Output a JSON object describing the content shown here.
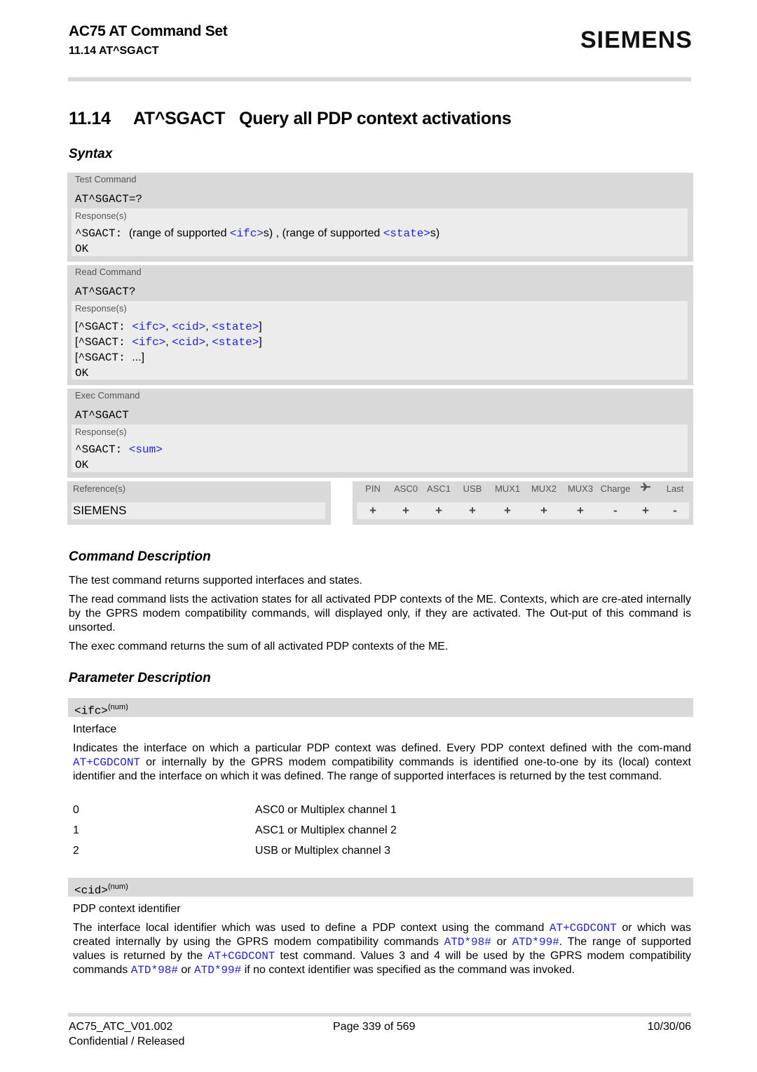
{
  "header": {
    "doc_title": "AC75 AT Command Set",
    "section_ref": "11.14 AT^SGACT",
    "logo": "SIEMENS"
  },
  "section": {
    "title": "11.14     AT^SGACT   Query all PDP context activations",
    "syntax_heading": "Syntax"
  },
  "syntax": {
    "test": {
      "label": "Test Command",
      "command": "AT^SGACT=?",
      "responses_label": "Response(s)",
      "lines": [
        {
          "prefix": "^SGACT: ",
          "t1": "(range of supported ",
          "p1": "<ifc>",
          "t2": "s) , (range of supported ",
          "p2": "<state>",
          "t3": "s)"
        },
        {
          "prefix": "OK"
        }
      ]
    },
    "read": {
      "label": "Read Command",
      "command": "AT^SGACT?",
      "responses_label": "Response(s)",
      "lines": [
        {
          "open": "[",
          "prefix": "^SGACT: ",
          "p1": "<ifc>",
          "sep1": ", ",
          "p2": "<cid>",
          "sep2": ", ",
          "p3": "<state>",
          "close": "]"
        },
        {
          "open": "[",
          "prefix": "^SGACT: ",
          "p1": "<ifc>",
          "sep1": ", ",
          "p2": "<cid>",
          "sep2": ", ",
          "p3": "<state>",
          "close": "]"
        },
        {
          "open": "[",
          "prefix": "^SGACT: ",
          "rest": "...]"
        },
        {
          "prefix": "OK"
        }
      ]
    },
    "exec": {
      "label": "Exec Command",
      "command": "AT^SGACT",
      "responses_label": "Response(s)",
      "lines": [
        {
          "prefix": "^SGACT: ",
          "p1": "<sum>"
        },
        {
          "prefix": "OK"
        }
      ]
    },
    "reference": {
      "label": "Reference(s)",
      "value": "SIEMENS"
    },
    "properties": {
      "headers": [
        "PIN",
        "ASC0",
        "ASC1",
        "USB",
        "MUX1",
        "MUX2",
        "MUX3",
        "Charge",
        "airplane-icon",
        "Last"
      ],
      "values": [
        "+",
        "+",
        "+",
        "+",
        "+",
        "+",
        "+",
        "-",
        "+",
        "-"
      ]
    }
  },
  "command_description": {
    "heading": "Command Description",
    "paragraphs": [
      "The test command returns supported interfaces and states.",
      "The read command lists the activation states for all activated PDP contexts of the ME. Contexts, which are cre-ated internally by the GPRS modem compatibility commands, will displayed only, if they are activated. The Out-put of this command is unsorted.",
      "The exec command returns the sum of all activated PDP contexts of the ME."
    ]
  },
  "parameter_description": {
    "heading": "Parameter Description",
    "params": [
      {
        "name": "<ifc>",
        "type": "(num)",
        "title": "Interface",
        "desc_parts": [
          "Indicates the interface on which a particular PDP context was defined. Every PDP context defined with the com-mand ",
          "AT+CGDCONT",
          " or internally by the GPRS modem compatibility commands is identified one-to-one by its (local) context identifier and the interface on which it was defined. The range of supported interfaces is returned by the test command."
        ],
        "values": [
          {
            "key": "0",
            "desc": "ASC0 or Multiplex channel 1"
          },
          {
            "key": "1",
            "desc": "ASC1 or Multiplex channel 2"
          },
          {
            "key": "2",
            "desc": "USB or Multiplex channel 3"
          }
        ]
      },
      {
        "name": "<cid>",
        "type": "(num)",
        "title": "PDP context identifier",
        "desc_parts": [
          "The interface local identifier which was used to define a PDP context using the command ",
          "AT+CGDCONT",
          " or which was created internally by using the GPRS modem compatibility commands ",
          "ATD*98#",
          " or ",
          "ATD*99#",
          ". The range of supported values is returned by the ",
          "AT+CGDCONT",
          " test command. Values 3 and 4 will be used by the GPRS modem compatibility commands ",
          "ATD*98#",
          " or ",
          "ATD*99#",
          " if no context identifier was specified as the command was invoked."
        ]
      }
    ]
  },
  "footer": {
    "doc_id": "AC75_ATC_V01.002",
    "page": "Page 339 of 569",
    "date": "10/30/06",
    "status": "Confidential / Released"
  },
  "colors": {
    "link": "#2222dd",
    "block_dark": "#d9d9d9",
    "block_light": "#ececec"
  }
}
